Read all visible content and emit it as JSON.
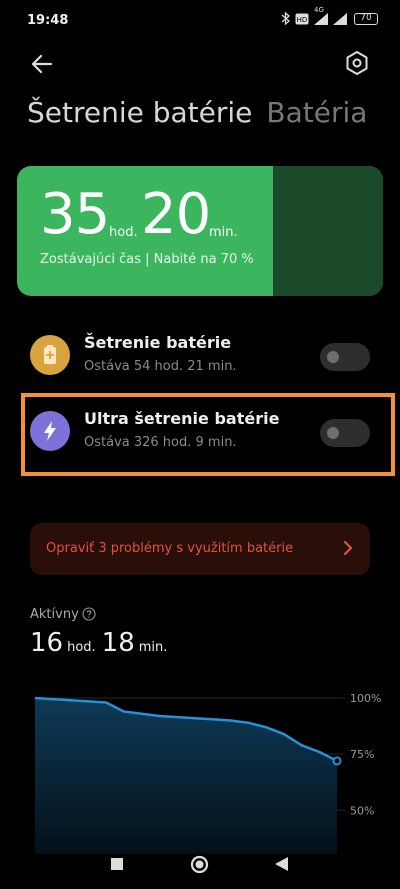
{
  "status_bar": {
    "time": "19:48",
    "battery_level": "70",
    "network": "4G",
    "icons": [
      "bluetooth-icon",
      "volte-icon",
      "4g-signal-icon",
      "signal-icon",
      "battery-icon"
    ]
  },
  "header": {
    "back_icon": "arrow-left-icon",
    "settings_icon": "gear-icon",
    "tabs": [
      {
        "label": "Šetrenie batérie",
        "active": true
      },
      {
        "label": "Batéria",
        "active": false
      }
    ]
  },
  "battery_card": {
    "hours": "35",
    "hours_unit": "hod.",
    "minutes": "20",
    "minutes_unit": "min.",
    "subtitle": "Zostávajúci čas | Nabité na 70 %",
    "charge_percent": 70,
    "color": "#3cb55f"
  },
  "modes": [
    {
      "title": "Šetrenie batérie",
      "subtitle": "Ostáva 54 hod. 21 min.",
      "icon": "battery-saver-icon",
      "icon_color": "#d8a43d",
      "enabled": false
    },
    {
      "title": "Ultra šetrenie batérie",
      "subtitle": "Ostáva 326 hod. 9 min.",
      "icon": "lightning-icon",
      "icon_color": "#7b73d9",
      "enabled": false
    }
  ],
  "fix_banner": {
    "text": "Opraviť 3 problémy s využitím batérie",
    "icon": "chevron-right-icon",
    "color": "#e0533f"
  },
  "active": {
    "label": "Aktívny",
    "hours": "16",
    "hours_unit": "hod.",
    "minutes": "18",
    "minutes_unit": "min."
  },
  "chart_data": {
    "type": "area",
    "y_tick_labels": [
      "100%",
      "75%",
      "50%"
    ],
    "ylim": [
      35,
      100
    ],
    "values": [
      100,
      99.5,
      99,
      98.5,
      98,
      94,
      93,
      92,
      91.5,
      91,
      90.5,
      90,
      89,
      87,
      84,
      79,
      76,
      72
    ],
    "color": "#2a8fd6"
  },
  "nav_bar": {
    "buttons": [
      "recents-square-icon",
      "home-circle-icon",
      "back-triangle-icon"
    ]
  },
  "highlight_color": "#f39138"
}
